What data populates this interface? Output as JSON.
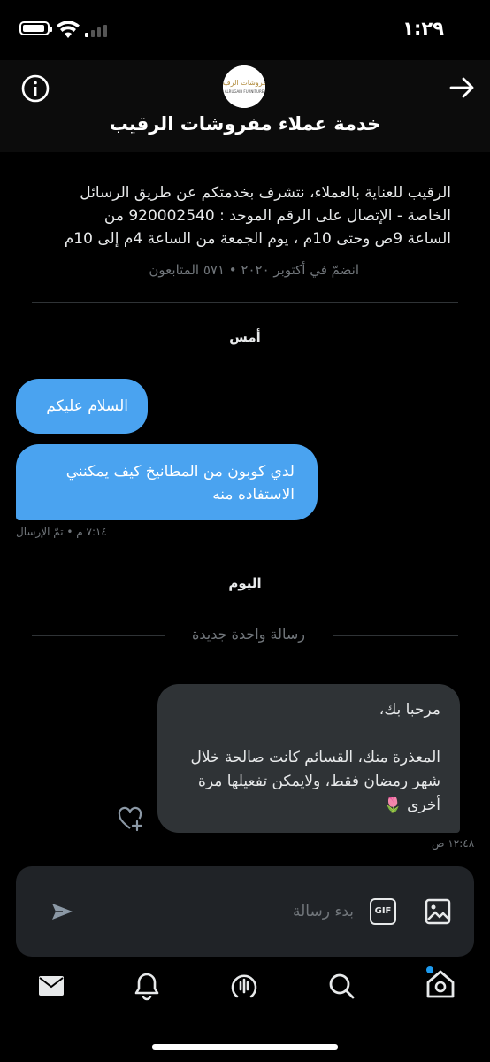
{
  "status_bar": {
    "time": "١:٢٩"
  },
  "header": {
    "title": "خدمة عملاء مفروشات الرقيب",
    "logo_text_top": "مفروشات الرقيب",
    "logo_text_bottom": "ALRUGAIB FURNITURE"
  },
  "profile": {
    "bio_lines": [
      "الرقيب للعناية بالعملاء، نتشرف بخدمتكم عن طريق الرسائل",
      "الخاصة - الإتصال على الرقم الموحد : 920002540 من",
      "الساعة 9ص وحتى 10م ، يوم الجمعة من الساعة 4م إلى 10م"
    ],
    "joined": "انضمّ في أكتوبر ٢٠٢٠ • ٥٧١ المتابعون"
  },
  "conversation": {
    "yesterday_label": "أمس",
    "sent_messages": [
      {
        "text": "السلام عليكم"
      },
      {
        "text": "لدي كوبون من المطانيخ كيف يمكنني الاستفاده منه"
      }
    ],
    "sent_meta": "٧:١٤ م • تمّ الإرسال",
    "today_label": "اليوم",
    "new_message_divider": "رسالة واحدة جديدة",
    "received_message": "مرحبا بك،\n\nالمعذرة منك، القسائم كانت صالحة خلال شهر رمضان فقط، ولايمكن تفعيلها مرة أخرى 🌷",
    "received_meta": "١٢:٤٨ ص"
  },
  "composer": {
    "placeholder": "بدء رسالة",
    "gif_label": "GIF"
  },
  "tabs": [
    "messages",
    "notifications",
    "spaces",
    "search",
    "home"
  ],
  "colors": {
    "accent": "#1d9bf0",
    "sent_bubble": "#4aa3f0",
    "received_bubble": "#2f3336",
    "muted": "#71767b"
  }
}
